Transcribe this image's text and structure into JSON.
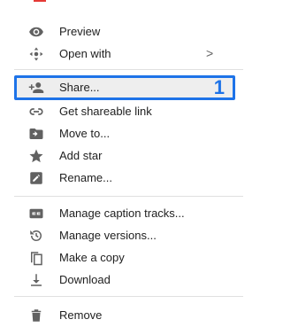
{
  "menu": {
    "items": [
      {
        "label": "Preview",
        "icon": "eye-icon"
      },
      {
        "label": "Open with",
        "icon": "open-with-icon",
        "chevron": ">"
      },
      {
        "label": "Share...",
        "icon": "add-person-icon",
        "badge": "1"
      },
      {
        "label": "Get shareable link",
        "icon": "link-icon"
      },
      {
        "label": "Move to...",
        "icon": "move-folder-icon"
      },
      {
        "label": "Add star",
        "icon": "star-icon"
      },
      {
        "label": "Rename...",
        "icon": "rename-icon"
      },
      {
        "label": "Manage caption tracks...",
        "icon": "caption-icon"
      },
      {
        "label": "Manage versions...",
        "icon": "history-icon"
      },
      {
        "label": "Make a copy",
        "icon": "copy-icon"
      },
      {
        "label": "Download",
        "icon": "download-icon"
      },
      {
        "label": "Remove",
        "icon": "trash-icon"
      }
    ]
  },
  "colors": {
    "icon": "#616161",
    "text": "#212121",
    "highlight_border": "#1e73e8",
    "highlight_bg": "#eeeeee",
    "divider": "#e0e0e0"
  }
}
